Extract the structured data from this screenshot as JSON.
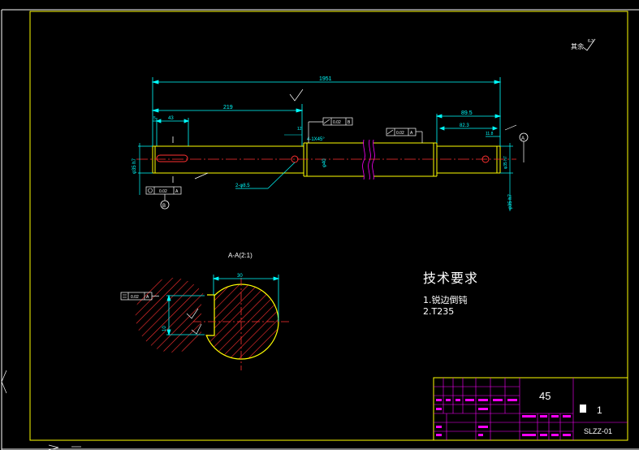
{
  "drawing": {
    "colors": {
      "background": "#000000",
      "border": "#ffffff",
      "frame": "#ffff00",
      "dimension": "#00ffff",
      "centerline": "#ff3030",
      "hatch": "#ff3030",
      "title_block": "#ff00ff",
      "text": "#ffffff"
    },
    "roughness_note": "其余",
    "dims": {
      "overall_length": "1951",
      "left_section": "219",
      "keyway_length": "43",
      "small_gap": "5",
      "right_length": "89.5",
      "right_inner": "82.3",
      "right_tail": "11.8",
      "step_gap": "12"
    },
    "callouts": {
      "chamfer": "4-1X45°",
      "holes": "2-φ8.5",
      "tol_left": "0.02",
      "tol_mid": "0.02",
      "tol_right": "0.02",
      "datum_a": "A",
      "datum_b": "B",
      "diameter_left": "φ35 h7",
      "diameter_right": "φ35 h7",
      "diameter_mid": "φ40"
    },
    "section": {
      "title": "A-A(2:1)",
      "width_dim": "30",
      "tol": "0.02",
      "datum": "A",
      "key_dim": "10"
    },
    "requirements": {
      "title": "技术要求",
      "items": [
        "1.锐边倒钝",
        "2.T235"
      ]
    },
    "title_block": {
      "material": "45",
      "scale": "1",
      "code": "SLZZ-01"
    }
  }
}
